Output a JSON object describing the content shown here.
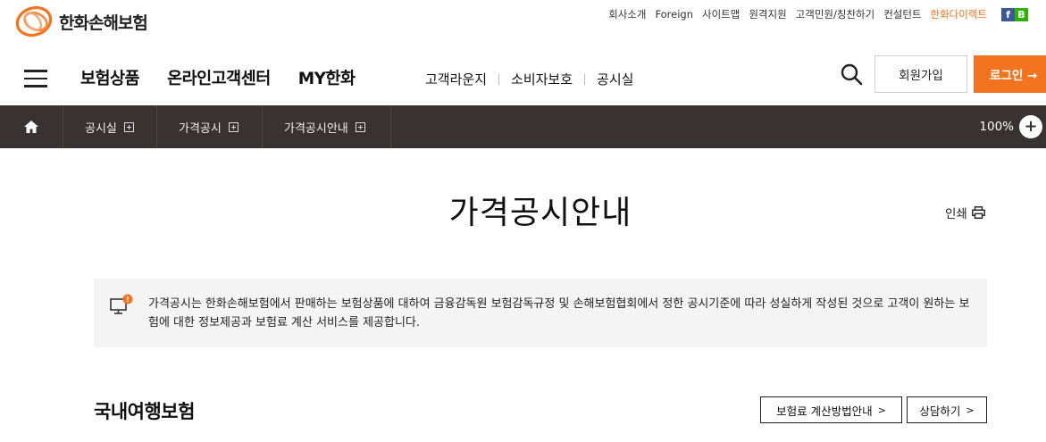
{
  "brand": {
    "name": "한화손해보험",
    "accent": "#f37321"
  },
  "util_links": [
    "회사소개",
    "Foreign",
    "사이트맵",
    "원격지원",
    "고객민원/칭찬하기",
    "컨설턴트"
  ],
  "util_direct": "한화다이렉트",
  "sns": {
    "facebook": "f",
    "blog": "B"
  },
  "menu_main": [
    "보험상품",
    "온라인고객센터",
    "MY한화"
  ],
  "menu_sub": [
    "고객라운지",
    "소비자보호",
    "공시실"
  ],
  "join_label": "회원가입",
  "login_label": "로그인 →",
  "breadcrumb": [
    "공시실",
    "가격공시",
    "가격공시안내"
  ],
  "zoom": {
    "level": "100%",
    "plus": "+"
  },
  "page_title": "가격공시안내",
  "print_label": "인쇄",
  "notice_badge": "!",
  "notice_text": "가격공시는 한화손해보험에서 판매하는 보험상품에 대하여 금융감독원 보험감독규정 및 손해보험협회에서 정한 공시기준에 따라 성실하게 작성된 것으로 고객이 원하는 보험에 대한 정보제공과 보험료 계산 서비스를 제공합니다.",
  "section_title": "국내여행보험",
  "calc_button": "보험료 계산방법안내",
  "consult_button": "상담하기",
  "chevron": ">"
}
